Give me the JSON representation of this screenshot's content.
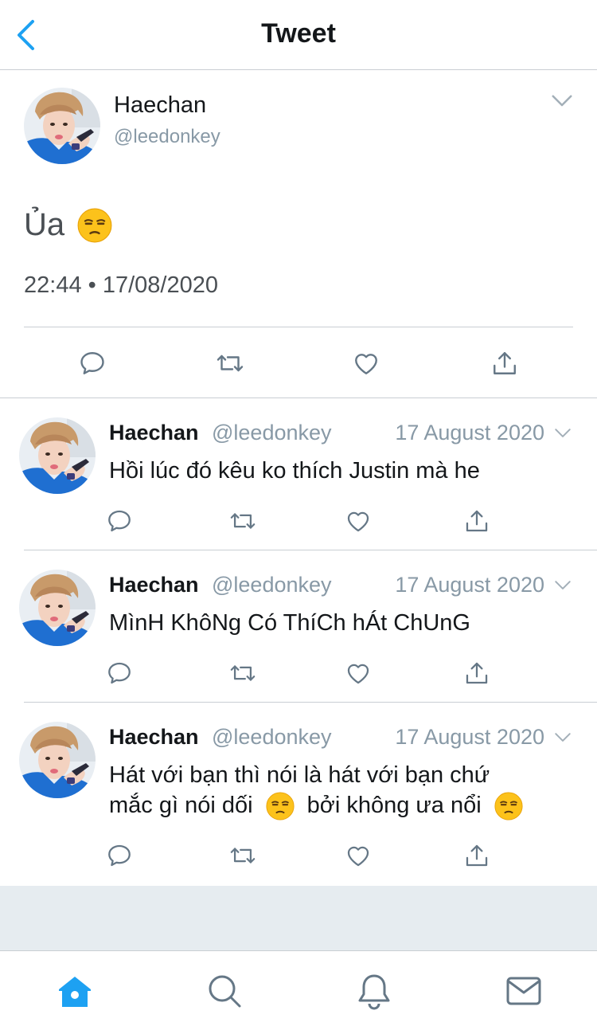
{
  "header": {
    "title": "Tweet",
    "back_icon": "chevron-left-icon",
    "accent": "#1da1f2"
  },
  "main_tweet": {
    "name": "Haechan",
    "handle": "@leedonkey",
    "text": "Ủa",
    "emoji": "unamused-face",
    "timestamp": "22:44 • 17/08/2020",
    "actions": [
      "reply-icon",
      "retweet-icon",
      "like-icon",
      "share-icon"
    ]
  },
  "replies": [
    {
      "name": "Haechan",
      "handle": "@leedonkey",
      "date": "17 August 2020",
      "text": "Hồi lúc đó kêu ko thích Justin mà he"
    },
    {
      "name": "Haechan",
      "handle": "@leedonkey",
      "date": "17 August 2020",
      "text": "MìnH KhôNg Có ThíCh hÁt ChUnG"
    },
    {
      "name": "Haechan",
      "handle": "@leedonkey",
      "date": "17 August 2020",
      "text_line1": "Hát với bạn thì nói là hát với bạn chứ",
      "text_line2a": "mắc gì nói dối",
      "text_line2b": "bởi không ưa nổi"
    }
  ],
  "tabbar": {
    "items": [
      "home-icon",
      "search-icon",
      "notifications-icon",
      "messages-icon"
    ],
    "active": "home-icon"
  },
  "colors": {
    "text": "#14171a",
    "secondary": "#8899a6",
    "divider": "#c9ced3",
    "icon": "#657786",
    "emoji_face": "#fcc21b"
  }
}
